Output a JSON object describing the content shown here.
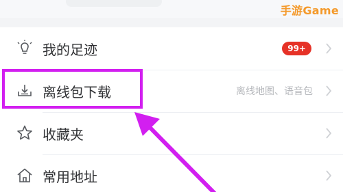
{
  "watermark": "手游Game",
  "menu": {
    "items": [
      {
        "label": "我的足迹",
        "badge": "99+",
        "icon": "bulb-icon"
      },
      {
        "label": "离线包下载",
        "right_text": "离线地图、语音包",
        "icon": "download-tray-icon"
      },
      {
        "label": "收藏夹",
        "icon": "star-icon"
      },
      {
        "label": "常用地址",
        "icon": "home-icon"
      }
    ]
  },
  "colors": {
    "highlight": "#d21ff0",
    "badge": "#e63227",
    "watermark": "#f49a2c"
  }
}
